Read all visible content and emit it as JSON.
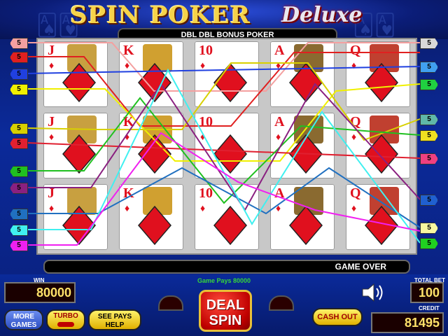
{
  "title": {
    "main": "SPIN POKER",
    "sub": "Deluxe"
  },
  "game_name": "DBL DBL BONUS POKER",
  "reels": [
    [
      {
        "rank": "J",
        "face": "jack"
      },
      {
        "rank": "J",
        "face": "jack"
      },
      {
        "rank": "J",
        "face": "jack"
      }
    ],
    [
      {
        "rank": "K",
        "face": "king"
      },
      {
        "rank": "K",
        "face": "king"
      },
      {
        "rank": "K",
        "face": "king"
      }
    ],
    [
      {
        "rank": "10",
        "face": "ten"
      },
      {
        "rank": "10",
        "face": "ten"
      },
      {
        "rank": "10",
        "face": "ten"
      }
    ],
    [
      {
        "rank": "A",
        "face": "ace"
      },
      {
        "rank": "A",
        "face": "ace"
      },
      {
        "rank": "A",
        "face": "ace"
      }
    ],
    [
      {
        "rank": "Q",
        "face": "queen"
      },
      {
        "rank": "Q",
        "face": "queen"
      },
      {
        "rank": "Q",
        "face": "queen"
      }
    ]
  ],
  "suit_icon": "diamond-icon",
  "payline_bet": "5",
  "left_tags": [
    {
      "value": "5",
      "color": "#f4a0a0"
    },
    {
      "value": "5",
      "color": "#e02020"
    },
    {
      "value": "5",
      "color": "#2040e0"
    },
    {
      "value": "5",
      "color": "#f0f000"
    },
    {
      "value": "5",
      "color": "#d8d000"
    },
    {
      "value": "5",
      "color": "#e02030"
    },
    {
      "value": "5",
      "color": "#20c020"
    },
    {
      "value": "5",
      "color": "#8a2080"
    },
    {
      "value": "5",
      "color": "#2070c0"
    },
    {
      "value": "5",
      "color": "#40f0f0"
    },
    {
      "value": "5",
      "color": "#f020f0"
    }
  ],
  "right_tags": [
    {
      "value": "5",
      "color": "#d8d8d8"
    },
    {
      "value": "5",
      "color": "#40a0f0"
    },
    {
      "value": "5",
      "color": "#20d040"
    },
    {
      "value": "5",
      "color": "#60b8a8"
    },
    {
      "value": "5",
      "color": "#f0e020"
    },
    {
      "value": "5",
      "color": "#f04080"
    },
    {
      "value": "5",
      "color": "#2060d0"
    },
    {
      "value": "5",
      "color": "#f8f8a0"
    },
    {
      "value": "5",
      "color": "#20d020"
    }
  ],
  "status": "GAME OVER",
  "game_pays": "Game Pays 80000",
  "win": {
    "label": "WIN",
    "value": "80000"
  },
  "total_bet": {
    "label": "TOTAL BET",
    "value": "100"
  },
  "credit": {
    "label": "CREDIT",
    "value": "81495"
  },
  "buttons": {
    "more_games": "MORE GAMES",
    "turbo": "TURBO",
    "see_pays": "SEE PAYS HELP",
    "deal_spin": "DEAL SPIN",
    "cash_out": "CASH OUT"
  },
  "colors": {
    "accent_gold": "#f6d34a",
    "card_red": "#e0101e",
    "win_green": "#37d43a"
  }
}
